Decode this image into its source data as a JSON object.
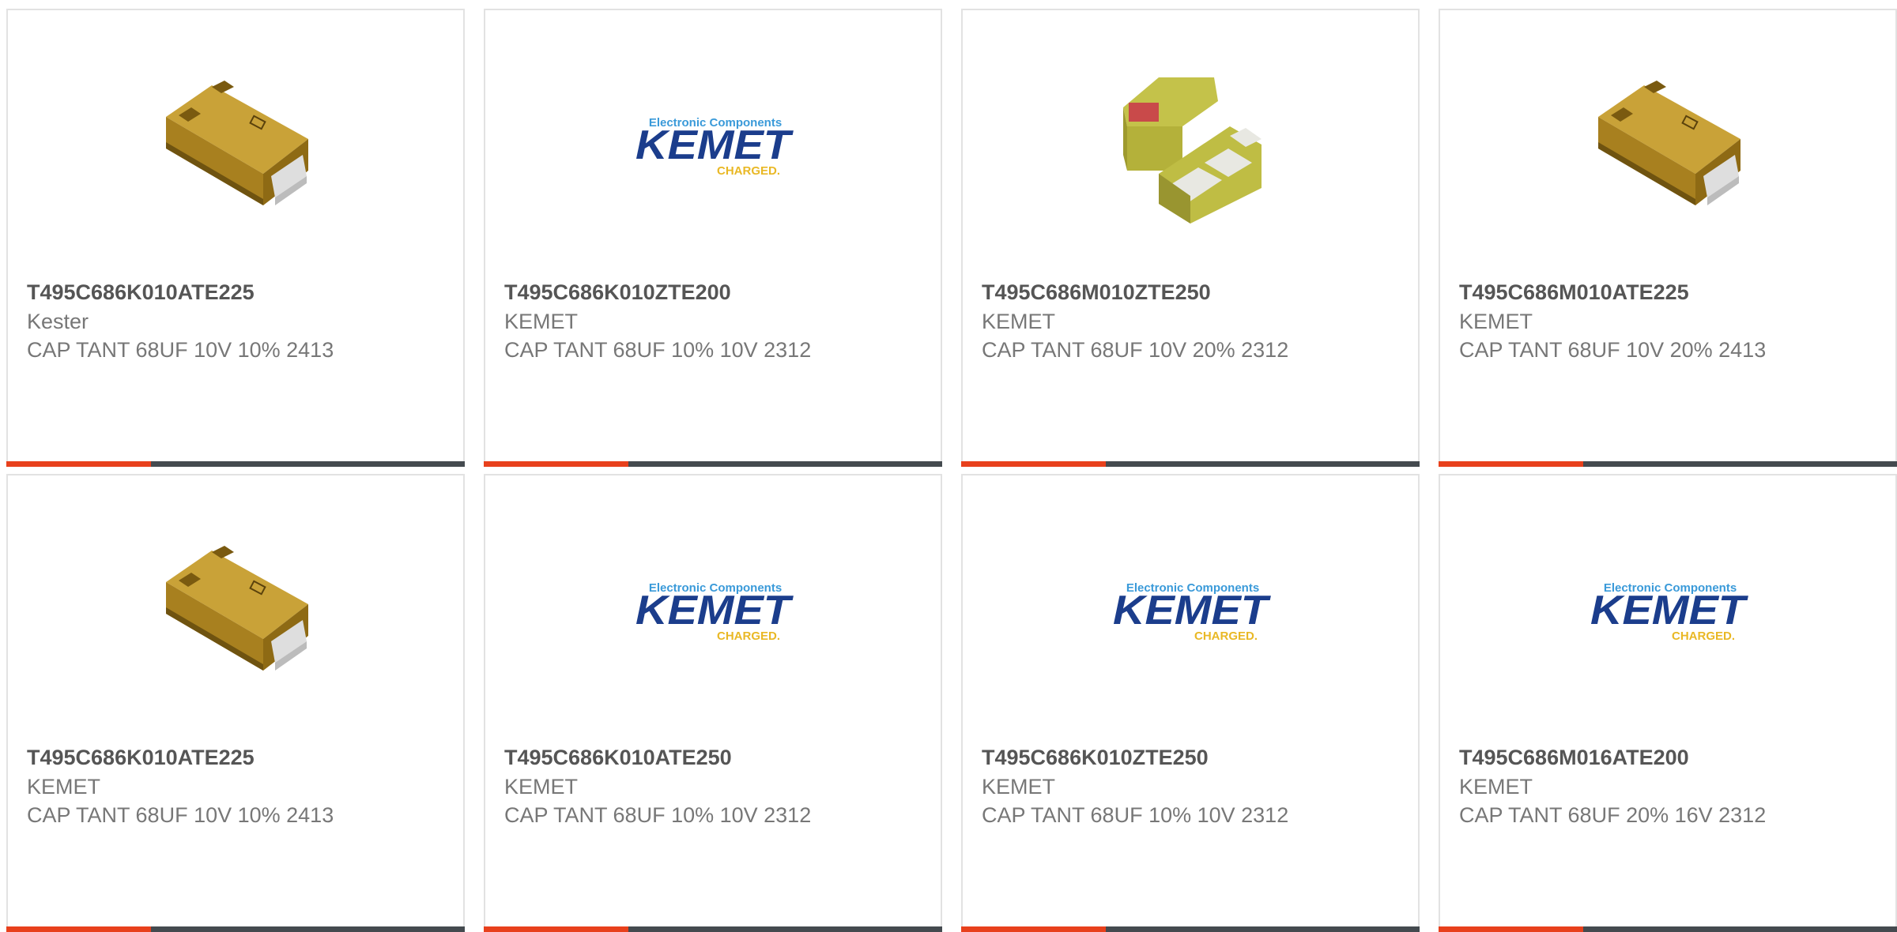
{
  "colors": {
    "accent": "#e8401c",
    "bar": "#444a4f",
    "border": "#e2e2e2"
  },
  "products": [
    {
      "part": "T495C686K010ATE225",
      "maker": "Kester",
      "desc": "CAP TANT 68UF 10V 10% 2413",
      "image": "tantalum-chip-icon"
    },
    {
      "part": "T495C686K010ZTE200",
      "maker": "KEMET",
      "desc": "CAP TANT 68UF 10% 10V 2312",
      "image": "kemet-logo"
    },
    {
      "part": "T495C686M010ZTE250",
      "maker": "KEMET",
      "desc": "CAP TANT 68UF 10V 20% 2312",
      "image": "green-chip-icon"
    },
    {
      "part": "T495C686M010ATE225",
      "maker": "KEMET",
      "desc": "CAP TANT 68UF 10V 20% 2413",
      "image": "tantalum-chip-icon"
    },
    {
      "part": "T495C686K010ATE225",
      "maker": "KEMET",
      "desc": "CAP TANT 68UF 10V 10% 2413",
      "image": "tantalum-chip-icon"
    },
    {
      "part": "T495C686K010ATE250",
      "maker": "KEMET",
      "desc": "CAP TANT 68UF 10% 10V 2312",
      "image": "kemet-logo"
    },
    {
      "part": "T495C686K010ZTE250",
      "maker": "KEMET",
      "desc": "CAP TANT 68UF 10% 10V 2312",
      "image": "kemet-logo"
    },
    {
      "part": "T495C686M016ATE200",
      "maker": "KEMET",
      "desc": "CAP TANT 68UF 20% 16V 2312",
      "image": "kemet-logo"
    }
  ],
  "logo": {
    "tagline": "Electronic Components",
    "name": "KEMET",
    "slogan": "CHARGED."
  }
}
